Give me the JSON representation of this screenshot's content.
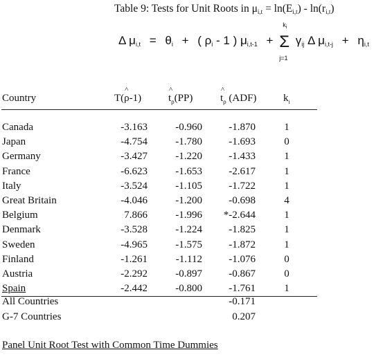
{
  "title": {
    "prefix": "Table 9: Tests for Unit Roots in ",
    "mu": "μ",
    "mu_sub": "i,t",
    "mid": " =  ln(E",
    "e_sub": "i,t",
    "mid2": ") - ln(r",
    "r_sub": "i,t",
    "end": ")"
  },
  "equation": {
    "lhs": "Δ μ",
    "lhs_sub": "i,t",
    "eq": "=",
    "theta": "θ",
    "theta_sub": "i",
    "plus": "+",
    "rho_open": "( ρ",
    "rho_sub": "i",
    "rho_close": " - 1 ) μ",
    "mu_lag_sub": "i,t-1",
    "sum": "Σ",
    "sum_top": "k",
    "sum_top_sub": "i",
    "sum_bot": "j=1",
    "gamma": "γ",
    "gamma_sub": "ij",
    "dmu": "Δ μ",
    "dmu_sub": "i,t-j",
    "eta": "η",
    "eta_sub": "i,t"
  },
  "table": {
    "headers": {
      "country": "Country",
      "t_rho_pre": "T(",
      "t_rho_hat": "ρ",
      "t_rho_post": "-1)",
      "pp_t": "t",
      "pp_sub": "ρ",
      "pp_label": "(PP)",
      "adf_t": "t",
      "adf_sub": "ρ",
      "adf_label": " (ADF)",
      "k": "k",
      "k_sub": "i"
    },
    "rows": [
      {
        "country": "Canada",
        "t_rho": "-3.163",
        "t_pp": "-0.960",
        "t_adf": "-1.870",
        "k": "1"
      },
      {
        "country": "Japan",
        "t_rho": "-4.754",
        "t_pp": "-1.780",
        "t_adf": "-1.693",
        "k": "0"
      },
      {
        "country": "Germany",
        "t_rho": "-3.427",
        "t_pp": "-1.220",
        "t_adf": "-1.433",
        "k": "1"
      },
      {
        "country": "France",
        "t_rho": "-6.623",
        "t_pp": "-1.653",
        "t_adf": "-2.617",
        "k": "1"
      },
      {
        "country": "Italy",
        "t_rho": "-3.524",
        "t_pp": "-1.105",
        "t_adf": "-1.722",
        "k": "1"
      },
      {
        "country": "Great Britain",
        "t_rho": "-4.046",
        "t_pp": "-1.200",
        "t_adf": "-0.698",
        "k": "4"
      },
      {
        "country": "Belgium",
        "t_rho": "7.866",
        "t_pp": "-1.996",
        "t_adf": "*-2.644",
        "k": "1"
      },
      {
        "country": "Denmark",
        "t_rho": "-3.528",
        "t_pp": "-1.224",
        "t_adf": "-1.825",
        "k": "1"
      },
      {
        "country": "Sweden",
        "t_rho": "-4.965",
        "t_pp": "-1.575",
        "t_adf": "-1.872",
        "k": "1"
      },
      {
        "country": "Finland",
        "t_rho": "-1.261",
        "t_pp": "-1.112",
        "t_adf": "-1.076",
        "k": "0"
      },
      {
        "country": "Austria",
        "t_rho": "-2.292",
        "t_pp": "-0.897",
        "t_adf": "-0.867",
        "k": "0"
      },
      {
        "country": "Spain",
        "t_rho": "-2.442",
        "t_pp": "-0.800",
        "t_adf": "-1.761",
        "k": "1"
      }
    ],
    "summary": [
      {
        "country": "All Countries",
        "t_adf": "-0.171"
      },
      {
        "country": "G-7 Countries",
        "t_adf": "0.207"
      }
    ]
  },
  "panel_heading": "Panel Unit Root Test with Common Time Dummies"
}
